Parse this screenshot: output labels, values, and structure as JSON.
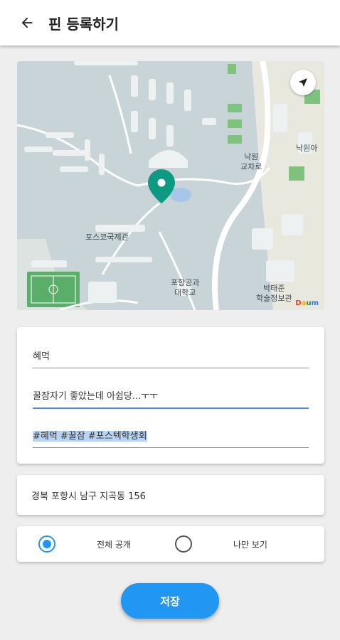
{
  "appbar": {
    "title": "핀 등록하기",
    "back_icon": "arrow-left-icon"
  },
  "map": {
    "labels": {
      "nakwon_intersection": "낙원\n교차로",
      "nakwon_apt": "낙원아",
      "international_hall": "포스코국제관",
      "postech": "포항공과\n대학교",
      "museum": "박태준\n학술정보관",
      "provider": "Daum"
    },
    "locate_icon": "navigation-arrow-icon",
    "pin_color": "#0e9a82"
  },
  "form": {
    "title_value": "혜먹",
    "description_value": "꿀잠자기 좋았는데 아쉽당...ㅜㅜ",
    "tags_value": "#혜먹 #꿀잠 #포스텍학생회"
  },
  "address": "경북 포항시 남구 지곡동 156",
  "privacy": {
    "public_label": "전체 공개",
    "private_label": "나만 보기",
    "selected": "public"
  },
  "save_label": "저장",
  "colors": {
    "accent": "#2196f3"
  }
}
